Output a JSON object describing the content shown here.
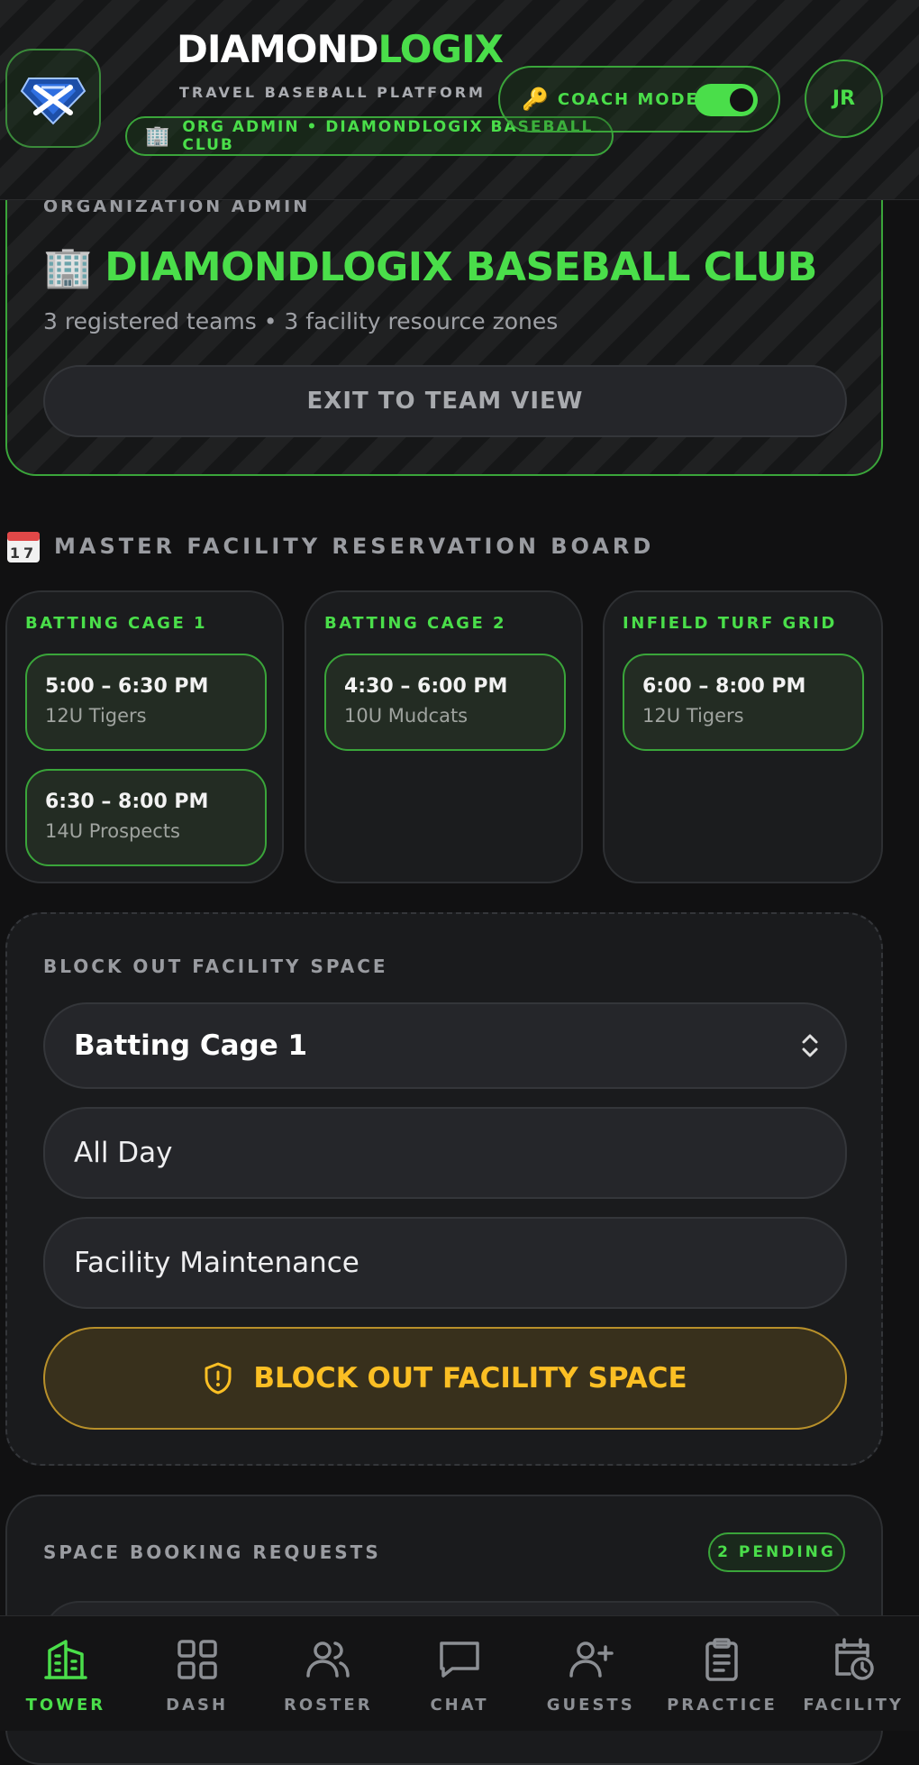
{
  "header": {
    "brand_part1": "DIAMOND",
    "brand_part2": "LOGIX",
    "tagline": "TRAVEL BASEBALL PLATFORM",
    "org_pill": "ORG ADMIN • DIAMONDLOGIX BASEBALL CLUB",
    "coach_mode_label": "COACH MODE",
    "coach_mode_on": true,
    "avatar_initials": "JR"
  },
  "org_card": {
    "eyebrow": "ORGANIZATION ADMIN",
    "title": "DIAMONDLOGIX BASEBALL CLUB",
    "subtitle": "3 registered teams • 3 facility resource zones",
    "exit_button": "EXIT TO TEAM VIEW"
  },
  "board": {
    "title": "MASTER FACILITY RESERVATION BOARD",
    "calendar_icon_day": "17",
    "columns": [
      {
        "name": "BATTING CAGE 1",
        "slots": [
          {
            "time": "5:00 – 6:30 PM",
            "team": "12U Tigers"
          },
          {
            "time": "6:30 – 8:00 PM",
            "team": "14U Prospects"
          }
        ]
      },
      {
        "name": "BATTING CAGE 2",
        "slots": [
          {
            "time": "4:30 – 6:00 PM",
            "team": "10U Mudcats"
          }
        ]
      },
      {
        "name": "INFIELD TURF GRID",
        "slots": [
          {
            "time": "6:00 – 8:00 PM",
            "team": "12U Tigers"
          }
        ]
      }
    ]
  },
  "block_out": {
    "label": "BLOCK OUT FACILITY SPACE",
    "resource_select": "Batting Cage 1",
    "time_field": "All Day",
    "reason_field": "Facility Maintenance",
    "submit_button": "BLOCK OUT FACILITY SPACE"
  },
  "requests": {
    "label": "SPACE BOOKING REQUESTS",
    "pending_badge": "2 PENDING"
  },
  "bottom_nav": {
    "items": [
      {
        "label": "TOWER",
        "icon": "building-icon",
        "active": true
      },
      {
        "label": "DASH",
        "icon": "grid-icon",
        "active": false
      },
      {
        "label": "ROSTER",
        "icon": "users-icon",
        "active": false
      },
      {
        "label": "CHAT",
        "icon": "chat-icon",
        "active": false
      },
      {
        "label": "GUESTS",
        "icon": "user-plus-icon",
        "active": false
      },
      {
        "label": "PRACTICE",
        "icon": "clipboard-icon",
        "active": false
      },
      {
        "label": "FACILITY",
        "icon": "calendar-clock-icon",
        "active": false
      }
    ]
  },
  "colors": {
    "accent_green": "#4ade4a",
    "warning_amber": "#fbbf24",
    "background": "#111112"
  }
}
